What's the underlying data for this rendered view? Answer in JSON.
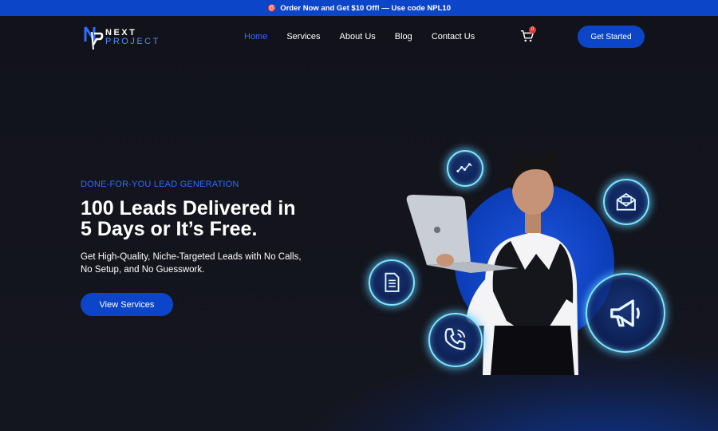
{
  "promo": {
    "emoji": "🎯",
    "text": "Order Now and Get $10 Off! — Use code NPL10"
  },
  "logo": {
    "line1": "NEXT",
    "line2": "PROJECT"
  },
  "nav": {
    "items": [
      {
        "label": "Home",
        "active": true
      },
      {
        "label": "Services"
      },
      {
        "label": "About Us"
      },
      {
        "label": "Blog"
      },
      {
        "label": "Contact Us"
      }
    ],
    "cart_count": "0",
    "cta_label": "Get Started"
  },
  "hero": {
    "eyebrow": "DONE-FOR-YOU LEAD GENERATION",
    "headline_line1": "100 Leads Delivered in",
    "headline_line2": "5 Days or It’s Free.",
    "subhead_line1": "Get High-Quality, Niche-Targeted Leads with No Calls,",
    "subhead_line2": "No Setup, and No Guesswork.",
    "button_label": "View Services",
    "bubble_icons": [
      "analytics-icon",
      "newsletter-icon",
      "document-icon",
      "megaphone-icon",
      "phone-call-icon"
    ]
  },
  "colors": {
    "accent": "#0c45c7",
    "link_active": "#2f6bff",
    "background": "#12131a",
    "glow": "#7fe7ff"
  }
}
